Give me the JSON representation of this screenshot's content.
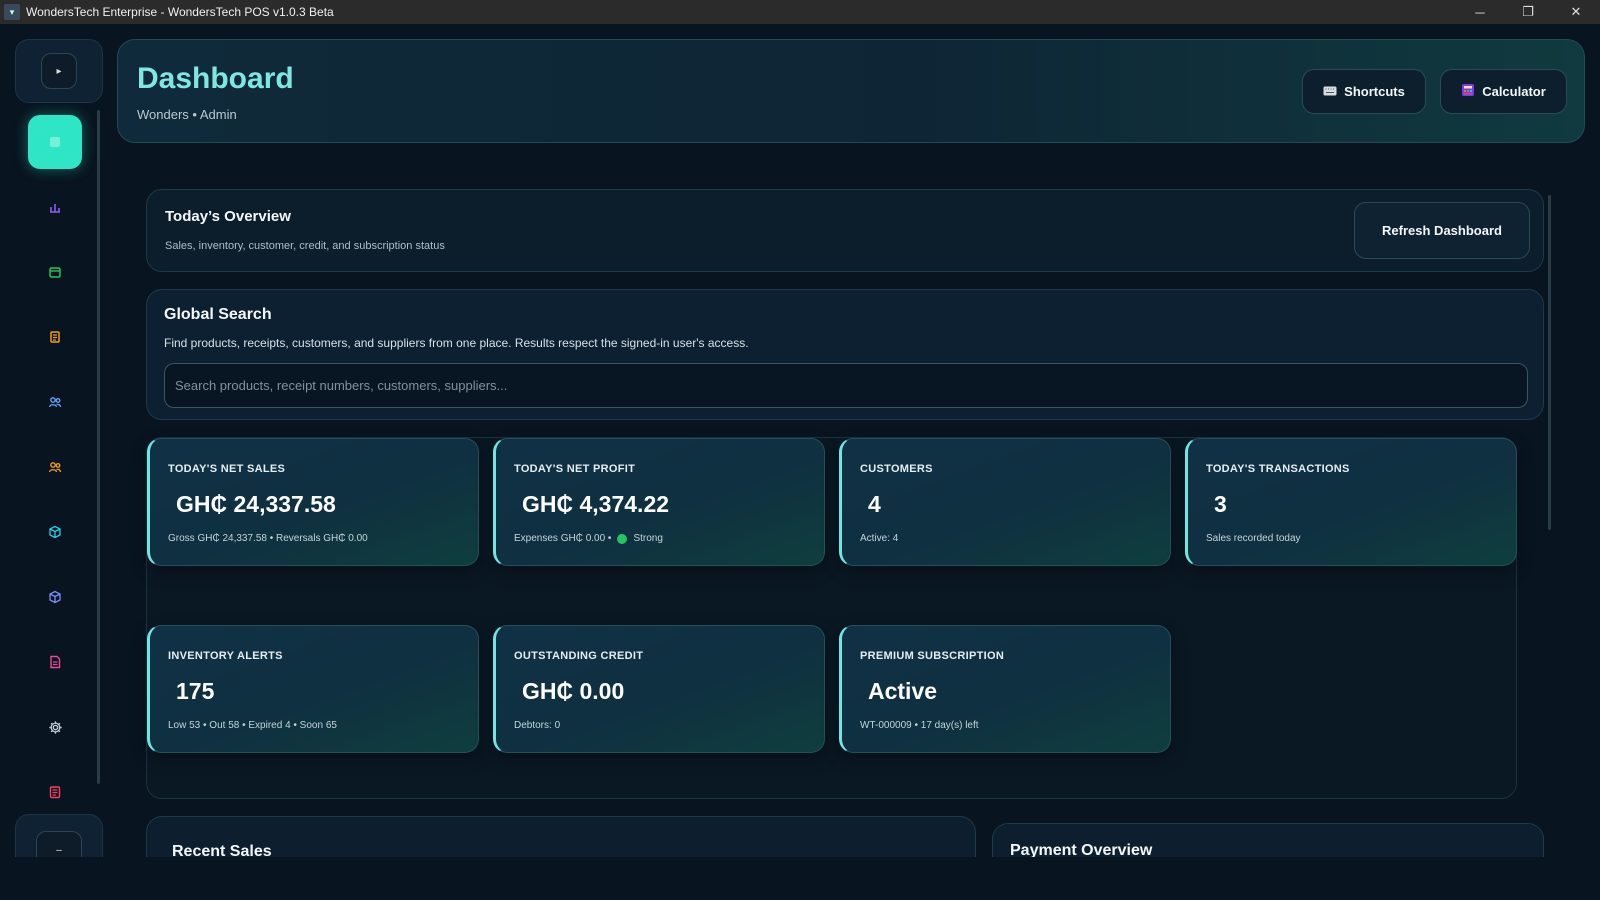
{
  "window": {
    "title": "WondersTech Enterprise - WondersTech POS v1.0.3 Beta",
    "controls": [
      "─",
      "❐",
      "✕"
    ]
  },
  "sidebar": {
    "toggle_icon": "▸",
    "bottom_icon": "–",
    "items": [
      {
        "name": "dashboard",
        "icon": "",
        "color": "#2ee6c5"
      },
      {
        "name": "reports",
        "icon": "📊",
        "color": "#8b5cf6"
      },
      {
        "name": "inventory",
        "icon": "▤",
        "color": "#22c55e"
      },
      {
        "name": "receipts",
        "icon": "▦",
        "color": "#f59e0b"
      },
      {
        "name": "customers",
        "icon": "👥",
        "color": "#60a5fa"
      },
      {
        "name": "suppliers",
        "icon": "👥",
        "color": "#f59e0b"
      },
      {
        "name": "products",
        "icon": "⬡",
        "color": "#22d3ee"
      },
      {
        "name": "stock",
        "icon": "⬡",
        "color": "#818cf8"
      },
      {
        "name": "documents",
        "icon": "▤",
        "color": "#ec4899"
      },
      {
        "name": "settings",
        "icon": "⚙",
        "color": "#cbd5e1"
      },
      {
        "name": "logs",
        "icon": "▤",
        "color": "#f43f5e"
      }
    ]
  },
  "header": {
    "title": "Dashboard",
    "subtitle": "Wonders • Admin",
    "shortcuts_label": "Shortcuts",
    "calculator_label": "Calculator"
  },
  "overview": {
    "title": "Today’s Overview",
    "subtitle": "Sales, inventory, customer, credit, and subscription status",
    "refresh_label": "Refresh Dashboard"
  },
  "search": {
    "title": "Global Search",
    "description": "Find products, receipts, customers, and suppliers from one place. Results respect the signed-in user's access.",
    "placeholder": "Search products, receipt numbers, customers, suppliers..."
  },
  "stats": {
    "net_sales": {
      "label": "TODAY'S NET SALES",
      "value": "GH₵ 24,337.58",
      "note": "Gross GH₵ 24,337.58 • Reversals GH₵ 0.00"
    },
    "net_profit": {
      "label": "TODAY'S NET PROFIT",
      "value": "GH₵ 4,374.22",
      "note_prefix": "Expenses GH₵ 0.00 •",
      "note_status": "Strong",
      "status_color": "#22c55e"
    },
    "customers": {
      "label": "CUSTOMERS",
      "value": "4",
      "note": "Active: 4"
    },
    "transactions": {
      "label": "TODAY'S TRANSACTIONS",
      "value": "3",
      "note": "Sales recorded today"
    },
    "inventory": {
      "label": "INVENTORY ALERTS",
      "value": "175",
      "note": "Low 53 • Out 58 • Expired 4 • Soon 65"
    },
    "credit": {
      "label": "OUTSTANDING CREDIT",
      "value": "GH₵ 0.00",
      "note": "Debtors: 0"
    },
    "subscription": {
      "label": "PREMIUM SUBSCRIPTION",
      "value": "Active",
      "note": "WT-000009 • 17 day(s) left"
    }
  },
  "bottom": {
    "recent_sales": "Recent Sales",
    "payment_overview": "Payment Overview"
  }
}
